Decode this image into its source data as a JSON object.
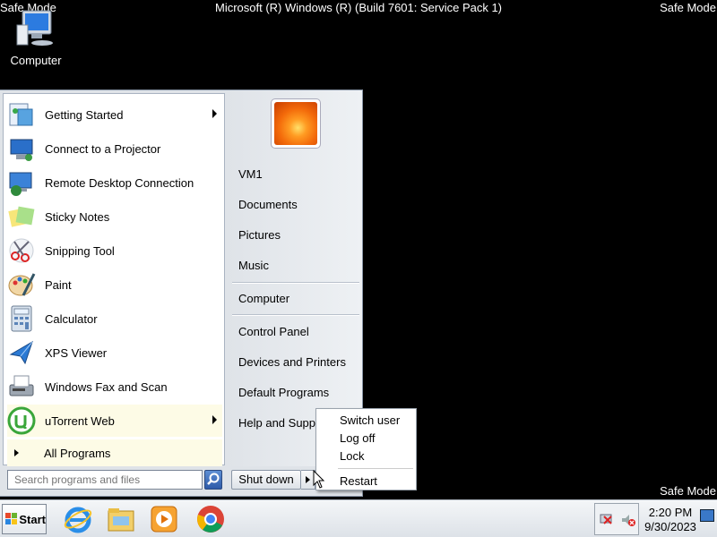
{
  "safe_mode_label": "Safe Mode",
  "window_title": "Microsoft (R) Windows (R) (Build 7601: Service Pack 1)",
  "desktop": {
    "icon_label": "Computer"
  },
  "start_menu": {
    "programs": [
      {
        "label": "Getting Started",
        "icon": "getting-started-icon",
        "has_submenu": true
      },
      {
        "label": "Connect to a Projector",
        "icon": "projector-icon",
        "has_submenu": false
      },
      {
        "label": "Remote Desktop Connection",
        "icon": "remote-desktop-icon",
        "has_submenu": false
      },
      {
        "label": "Sticky Notes",
        "icon": "sticky-notes-icon",
        "has_submenu": false
      },
      {
        "label": "Snipping Tool",
        "icon": "snipping-tool-icon",
        "has_submenu": false
      },
      {
        "label": "Paint",
        "icon": "paint-icon",
        "has_submenu": false
      },
      {
        "label": "Calculator",
        "icon": "calculator-icon",
        "has_submenu": false
      },
      {
        "label": "XPS Viewer",
        "icon": "xps-viewer-icon",
        "has_submenu": false
      },
      {
        "label": "Windows Fax and Scan",
        "icon": "fax-scan-icon",
        "has_submenu": false
      },
      {
        "label": "uTorrent Web",
        "icon": "utorrent-icon",
        "has_submenu": true
      }
    ],
    "all_programs": "All Programs",
    "search_placeholder": "Search programs and files",
    "right_links": [
      "VM1",
      "Documents",
      "Pictures",
      "Music",
      "Computer",
      "Control Panel",
      "Devices and Printers",
      "Default Programs",
      "Help and Support"
    ],
    "shutdown_label": "Shut down",
    "shutdown_menu": [
      "Switch user",
      "Log off",
      "Lock",
      "Restart"
    ]
  },
  "taskbar": {
    "start_label": "Start",
    "pinned": [
      "internet-explorer-icon",
      "file-explorer-icon",
      "media-player-icon",
      "chrome-icon"
    ],
    "clock_time": "2:20 PM",
    "clock_date": "9/30/2023"
  }
}
